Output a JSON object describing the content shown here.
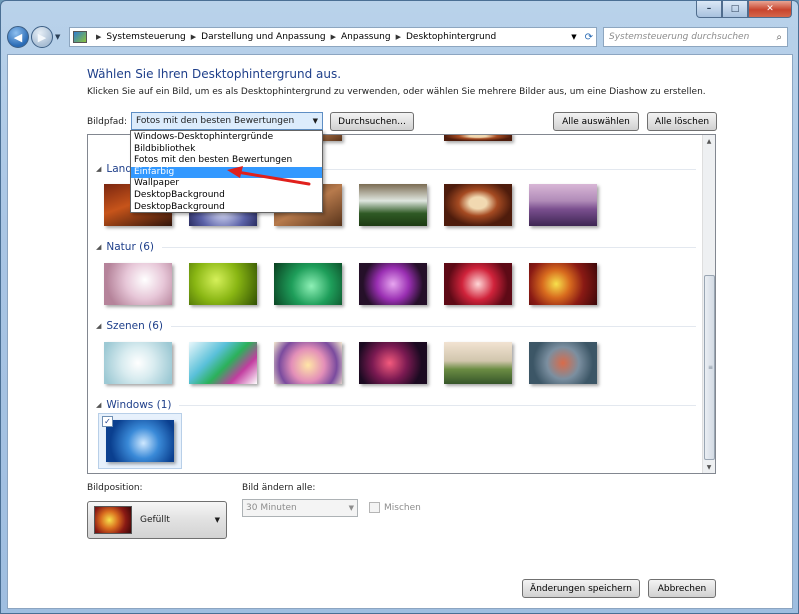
{
  "window": {
    "min_glyph": "–",
    "max_glyph": "□",
    "close_glyph": "✕"
  },
  "nav": {
    "breadcrumbs": [
      "Systemsteuerung",
      "Darstellung und Anpassung",
      "Anpassung",
      "Desktophintergrund"
    ],
    "search_placeholder": "Systemsteuerung durchsuchen"
  },
  "page": {
    "heading": "Wählen Sie Ihren Desktophintergrund aus.",
    "subtext": "Klicken Sie auf ein Bild, um es als Desktophintergrund zu verwenden, oder wählen Sie mehrere Bilder aus, um eine Diashow zu erstellen.",
    "bildpfad_label": "Bildpfad:",
    "bildpfad_value": "Fotos mit den besten Bewertungen",
    "browse_label": "Durchsuchen...",
    "select_all_label": "Alle auswählen",
    "clear_all_label": "Alle löschen"
  },
  "dropdown": {
    "options": [
      "Windows-Desktophintergründe",
      "Bildbibliothek",
      "Fotos mit den besten Bewertungen",
      "Einfarbig",
      "Wallpaper",
      "DesktopBackground",
      "DesktopBackground"
    ],
    "highlighted": "Einfarbig"
  },
  "groups": {
    "landschaften": "Lands",
    "natur": "Natur (6)",
    "szenen": "Szenen (6)",
    "windows": "Windows (1)"
  },
  "bottom": {
    "position_label": "Bildposition:",
    "position_value": "Gefüllt",
    "interval_label": "Bild ändern alle:",
    "interval_value": "30 Minuten",
    "shuffle_label": "Mischen",
    "save_label": "Änderungen speichern",
    "cancel_label": "Abbrechen"
  },
  "colors": {
    "heading": "#1e3f8a",
    "selection": "#3399ff",
    "annotation_arrow": "#e0201c"
  }
}
